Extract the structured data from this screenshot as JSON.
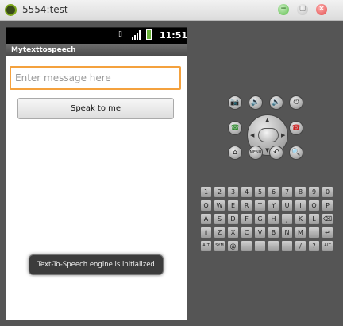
{
  "window": {
    "title": "5554:test",
    "min_symbol": "−",
    "max_symbol": "▢",
    "close_symbol": "×"
  },
  "status_bar": {
    "time": "11:51"
  },
  "app": {
    "title": "Mytexttospeech",
    "message_placeholder": "Enter message here",
    "message_value": "",
    "speak_button": "Speak to me",
    "toast": "Text-To-Speech engine is initialized"
  },
  "controls": {
    "top_row": [
      "📷",
      "🔉",
      "🔊",
      "⏻"
    ],
    "call": "☎",
    "end_call": "☎",
    "bottom_row": [
      "⌂",
      "MENU",
      "↶",
      "🔍"
    ]
  },
  "keyboard": {
    "rows": [
      [
        "1",
        "2",
        "3",
        "4",
        "5",
        "6",
        "7",
        "8",
        "9",
        "0"
      ],
      [
        "Q",
        "W",
        "E",
        "R",
        "T",
        "Y",
        "U",
        "I",
        "O",
        "P"
      ],
      [
        "A",
        "S",
        "D",
        "F",
        "G",
        "H",
        "J",
        "K",
        "L",
        "⌫"
      ],
      [
        "⇧",
        "Z",
        "X",
        "C",
        "V",
        "B",
        "N",
        "M",
        ".",
        "↵"
      ],
      [
        "ALT",
        "SYM",
        "@",
        "",
        "",
        "",
        "",
        "/",
        "?",
        "ALT"
      ]
    ]
  }
}
